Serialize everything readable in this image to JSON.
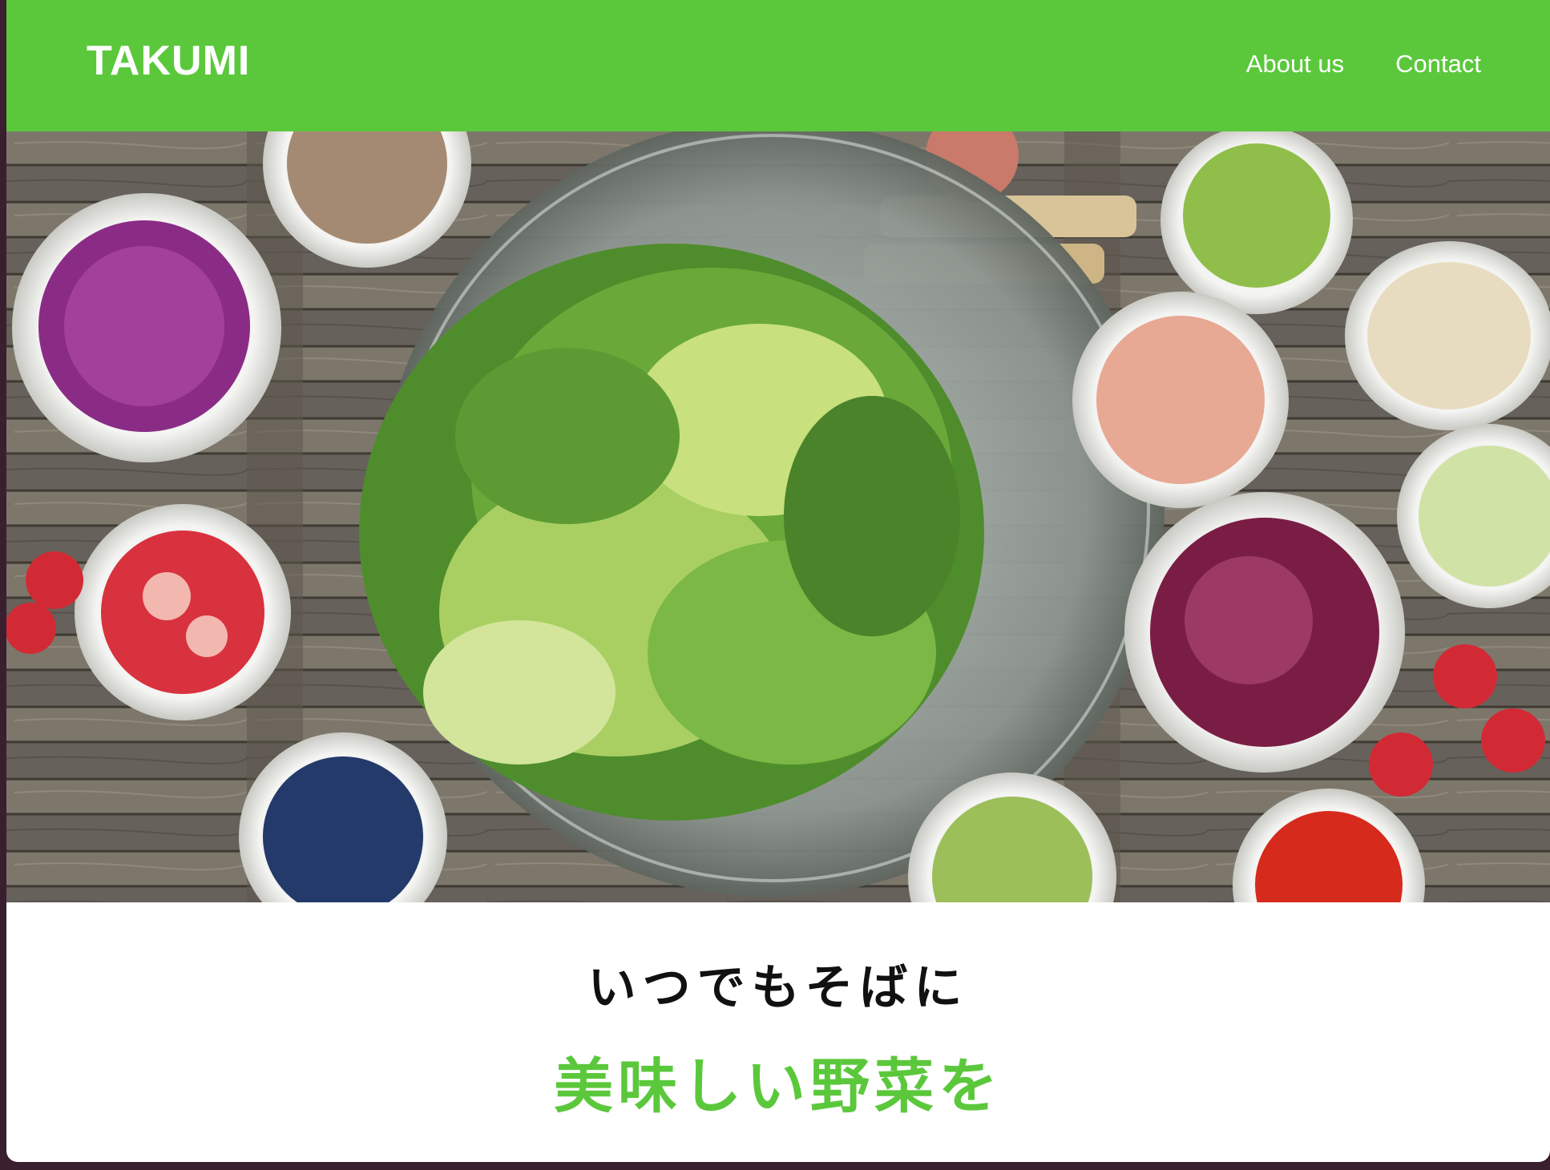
{
  "header": {
    "brand": "TAKUMI",
    "nav": [
      {
        "label": "About us"
      },
      {
        "label": "Contact"
      }
    ]
  },
  "hero": {
    "image_description_icon": "salad-photo"
  },
  "tagline": {
    "line1": "いつでもそばに",
    "line2": "美味しい野菜を"
  },
  "colors": {
    "brand_green": "#5bc83c",
    "text_dark": "#111111",
    "white": "#ffffff"
  }
}
